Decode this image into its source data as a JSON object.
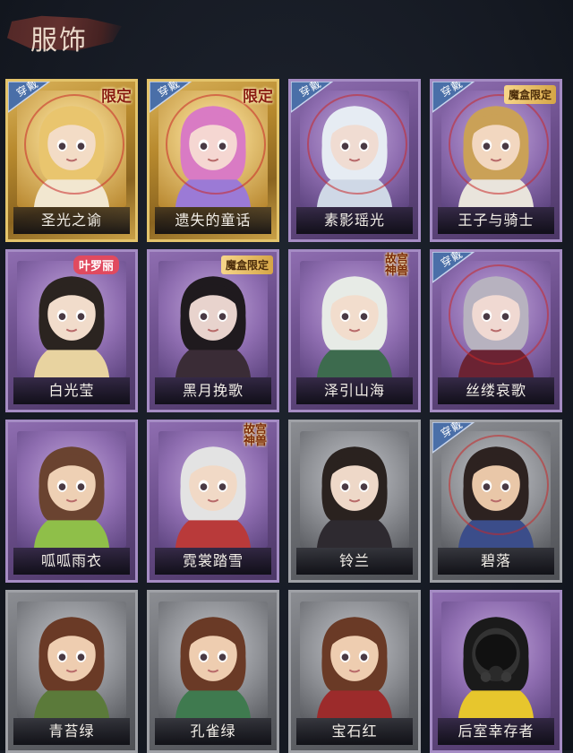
{
  "header": {
    "title": "服饰"
  },
  "wear_badge": "穿戴",
  "colors": {
    "gold": "#c9a046",
    "purple": "#8e6db0",
    "grey": "#8b8d92",
    "label_text": "#f3efe8"
  },
  "cards": [
    {
      "name": "圣光之谕",
      "tier": "gold",
      "worn": true,
      "tag": "限定",
      "tag_style": "plain"
    },
    {
      "name": "遗失的童话",
      "tier": "gold",
      "worn": true,
      "tag": "限定",
      "tag_style": "plain"
    },
    {
      "name": "素影瑶光",
      "tier": "purple",
      "worn": true,
      "tag": "",
      "tag_style": ""
    },
    {
      "name": "王子与骑士",
      "tier": "purple",
      "worn": true,
      "tag": "魔盒限定",
      "tag_style": "box"
    },
    {
      "name": "白光莹",
      "tier": "purple",
      "worn": false,
      "tag": "叶罗丽",
      "tag_style": "yeluoli"
    },
    {
      "name": "黑月挽歌",
      "tier": "purple",
      "worn": false,
      "tag": "魔盒限定",
      "tag_style": "box"
    },
    {
      "name": "泽引山海",
      "tier": "purple",
      "worn": false,
      "tag": "故宫神兽",
      "tag_style": "gugong"
    },
    {
      "name": "丝缕哀歌",
      "tier": "purple",
      "worn": true,
      "tag": "",
      "tag_style": ""
    },
    {
      "name": "呱呱雨衣",
      "tier": "purple",
      "worn": false,
      "tag": "",
      "tag_style": ""
    },
    {
      "name": "霓裳踏雪",
      "tier": "purple",
      "worn": false,
      "tag": "故宫神兽",
      "tag_style": "gugong"
    },
    {
      "name": "铃兰",
      "tier": "grey",
      "worn": false,
      "tag": "",
      "tag_style": ""
    },
    {
      "name": "碧落",
      "tier": "grey",
      "worn": true,
      "tag": "",
      "tag_style": ""
    },
    {
      "name": "青苔绿",
      "tier": "grey",
      "worn": false,
      "tag": "",
      "tag_style": ""
    },
    {
      "name": "孔雀绿",
      "tier": "grey",
      "worn": false,
      "tag": "",
      "tag_style": ""
    },
    {
      "name": "宝石红",
      "tier": "grey",
      "worn": false,
      "tag": "",
      "tag_style": ""
    },
    {
      "name": "后室幸存者",
      "tier": "purple",
      "worn": false,
      "tag": "",
      "tag_style": ""
    }
  ],
  "portraits": [
    {
      "hair": "#e9c56e",
      "skin": "#f3dcc6",
      "outfit": "#f2e7d0",
      "icon": "gold-angel-portrait-icon"
    },
    {
      "hair": "#d97bc4",
      "skin": "#f5d7d2",
      "outfit": "#9b7ad6",
      "icon": "pink-fairy-portrait-icon"
    },
    {
      "hair": "#e6ecf3",
      "skin": "#f0dcd2",
      "outfit": "#cfd8e6",
      "icon": "silver-hair-portrait-icon"
    },
    {
      "hair": "#caa157",
      "skin": "#f2d7c0",
      "outfit": "#e9e4dc",
      "icon": "prince-portrait-icon"
    },
    {
      "hair": "#2b2420",
      "skin": "#f1dccb",
      "outfit": "#e8d3a0",
      "icon": "crowned-lady-portrait-icon"
    },
    {
      "hair": "#1f1a1e",
      "skin": "#e8d3cd",
      "outfit": "#3a2c36",
      "icon": "black-hair-portrait-icon"
    },
    {
      "hair": "#e7ebe6",
      "skin": "#f2ddcd",
      "outfit": "#3d6b4e",
      "icon": "horned-boy-portrait-icon"
    },
    {
      "hair": "#b7b2bf",
      "skin": "#f0d9d2",
      "outfit": "#6b2333",
      "icon": "gothic-girl-portrait-icon"
    },
    {
      "hair": "#6a4330",
      "skin": "#eed0b4",
      "outfit": "#8fbf49",
      "icon": "frog-raincoat-portrait-icon"
    },
    {
      "hair": "#e3e3e3",
      "skin": "#f1d9c6",
      "outfit": "#b93a3a",
      "icon": "fox-girl-portrait-icon"
    },
    {
      "hair": "#2a221f",
      "skin": "#eed8c8",
      "outfit": "#2e2a30",
      "icon": "lily-lady-portrait-icon"
    },
    {
      "hair": "#2d2220",
      "skin": "#e9c7a8",
      "outfit": "#3b4d8a",
      "icon": "young-man-portrait-icon"
    },
    {
      "hair": "#6a3a26",
      "skin": "#eecdb0",
      "outfit": "#5b7a3a",
      "icon": "moss-green-portrait-icon"
    },
    {
      "hair": "#6a3a26",
      "skin": "#eecdb0",
      "outfit": "#3f7a4f",
      "icon": "peacock-green-portrait-icon"
    },
    {
      "hair": "#6a3a26",
      "skin": "#eecdb0",
      "outfit": "#9c2b2b",
      "icon": "gem-red-portrait-icon"
    },
    {
      "hair": "#1a1a1a",
      "skin": "#333333",
      "outfit": "#e7c62d",
      "icon": "gas-mask-portrait-icon"
    }
  ]
}
